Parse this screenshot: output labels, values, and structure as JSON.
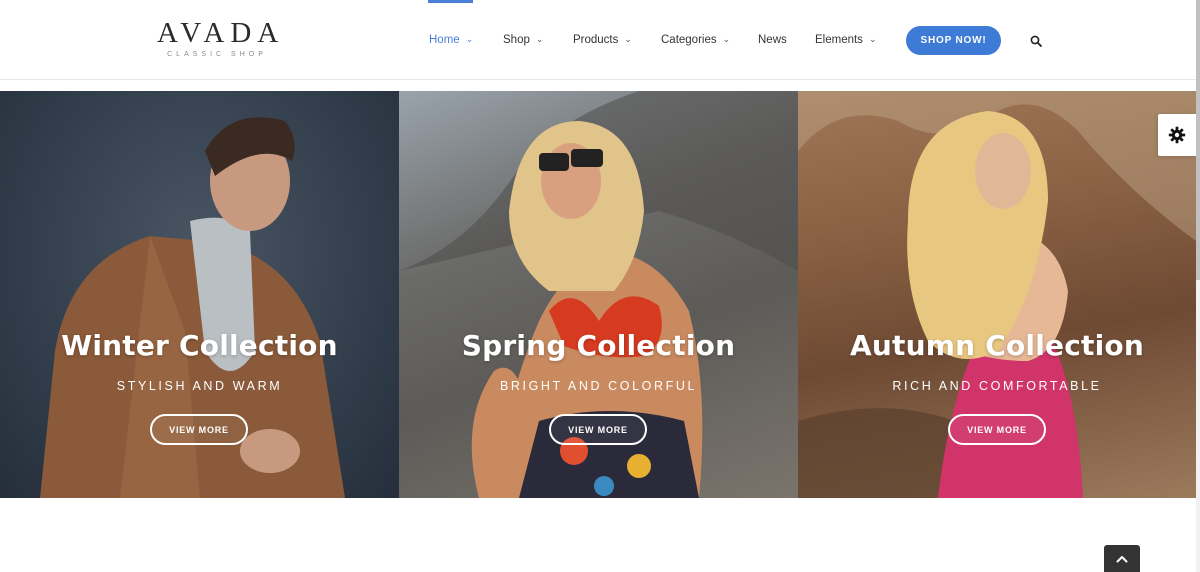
{
  "logo": {
    "main": "AVADA",
    "sub": "CLASSIC SHOP"
  },
  "nav": {
    "items": [
      {
        "label": "Home",
        "dropdown": true,
        "active": true
      },
      {
        "label": "Shop",
        "dropdown": true
      },
      {
        "label": "Products",
        "dropdown": true
      },
      {
        "label": "Categories",
        "dropdown": true
      },
      {
        "label": "News",
        "dropdown": false
      },
      {
        "label": "Elements",
        "dropdown": true
      }
    ],
    "cta_label": "SHOP NOW!",
    "search_icon": "search-icon"
  },
  "collections": [
    {
      "title": "Winter Collection",
      "subtitle": "STYLISH AND WARM",
      "button": "VIEW MORE"
    },
    {
      "title": "Spring Collection",
      "subtitle": "BRIGHT AND COLORFUL",
      "button": "VIEW MORE"
    },
    {
      "title": "Autumn Collection",
      "subtitle": "RICH AND COMFORTABLE",
      "button": "VIEW MORE"
    }
  ],
  "icons": {
    "settings": "gear-icon",
    "to_top": "chevron-up-icon",
    "chevron": "chevron-down-icon"
  },
  "colors": {
    "accent": "#4a80d9",
    "cta": "#3d7bd6",
    "text": "#333333"
  }
}
